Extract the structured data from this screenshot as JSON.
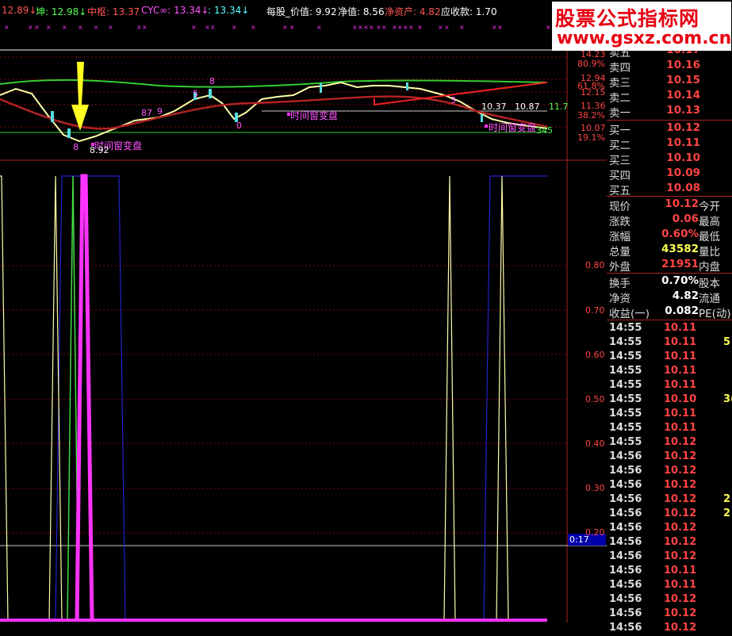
{
  "topbar": {
    "items": [
      {
        "text": "12.89↓",
        "color": "#ff5555"
      },
      {
        "text": "坤: 12.98↓",
        "color": "#55ff55"
      },
      {
        "text": "中枢: 13.37",
        "color": "#ff5555"
      },
      {
        "text": "CYC∞: 13.34↓",
        "color": "#ff55ff"
      },
      {
        "text": ": 13.34↓",
        "color": "#55ffff"
      },
      {
        "text": "每股_价值: 9.92",
        "color": "#ffffff"
      },
      {
        "text": "净值: 8.56",
        "color": "#ffffff"
      },
      {
        "text": "净资产: 4.82",
        "color": "#ff5555"
      },
      {
        "text": "应收款: 1.70",
        "color": "#ffffff"
      }
    ]
  },
  "logo": {
    "line1": "股票公式指标网",
    "line2": "www.gsxz.com.cn"
  },
  "upper_axis": {
    "prices": [
      "14.23",
      "12.94",
      "12.15",
      "11.36",
      "10.07"
    ],
    "percents": [
      "80.9%",
      "61.8%",
      "38.2%",
      "19.1%"
    ]
  },
  "upper_annotations": {
    "label1": "时间窗变盘",
    "label2": "时间窗变盘",
    "label3": "时间窗变盘",
    "low_value": "8.92",
    "low_prefix": "8",
    "val_1037": "10.37",
    "val_1087": "10.87",
    "val_117": "11.7",
    "num_8": "8",
    "num_5": "5",
    "num_0": "0",
    "num_87": "87",
    "num_9": "9",
    "num_345": "345",
    "num_3": "3"
  },
  "lower_axis": {
    "labels": [
      "0.80",
      "0.70",
      "0.60",
      "0.50",
      "0.40",
      "0.30",
      "0.20"
    ],
    "current": "0:17"
  },
  "order_book": {
    "asks": [
      {
        "label": "卖五",
        "price": "10.17"
      },
      {
        "label": "卖四",
        "price": "10.16"
      },
      {
        "label": "卖三",
        "price": "10.15"
      },
      {
        "label": "卖二",
        "price": "10.14"
      },
      {
        "label": "卖一",
        "price": "10.13"
      }
    ],
    "bids": [
      {
        "label": "买一",
        "price": "10.12"
      },
      {
        "label": "买二",
        "price": "10.11"
      },
      {
        "label": "买三",
        "price": "10.10"
      },
      {
        "label": "买四",
        "price": "10.09"
      },
      {
        "label": "买五",
        "price": "10.08"
      }
    ]
  },
  "stats": [
    {
      "label": "现价",
      "value": "10.12",
      "color": "#ff4444",
      "right": "今开"
    },
    {
      "label": "涨跌",
      "value": "0.06",
      "color": "#ff4444",
      "right": "最高"
    },
    {
      "label": "涨幅",
      "value": "0.60%",
      "color": "#ff4444",
      "right": "最低"
    },
    {
      "label": "总量",
      "value": "43582",
      "color": "#ffff55",
      "right": "量比"
    },
    {
      "label": "外盘",
      "value": "21951",
      "color": "#ff4444",
      "right": "内盘"
    }
  ],
  "stats2": [
    {
      "label": "换手",
      "value": "0.70%",
      "color": "#ffffff",
      "right": "股本"
    },
    {
      "label": "净资",
      "value": "4.82",
      "color": "#ffffff",
      "right": "流通"
    },
    {
      "label": "收益(一)",
      "value": "0.082",
      "color": "#ffffff",
      "right": "PE(动)"
    }
  ],
  "ticks": [
    {
      "time": "14:55",
      "price": "10.11",
      "color": "#ff4444",
      "vol": ""
    },
    {
      "time": "14:55",
      "price": "10.11",
      "color": "#ff4444",
      "vol": "5"
    },
    {
      "time": "14:55",
      "price": "10.11",
      "color": "#ff4444",
      "vol": ""
    },
    {
      "time": "14:55",
      "price": "10.11",
      "color": "#ff4444",
      "vol": ""
    },
    {
      "time": "14:55",
      "price": "10.11",
      "color": "#ff4444",
      "vol": ""
    },
    {
      "time": "14:55",
      "price": "10.10",
      "color": "#ff4444",
      "vol": "3("
    },
    {
      "time": "14:55",
      "price": "10.11",
      "color": "#ff4444",
      "vol": ""
    },
    {
      "time": "14:55",
      "price": "10.11",
      "color": "#ff4444",
      "vol": ""
    },
    {
      "time": "14:55",
      "price": "10.12",
      "color": "#ff4444",
      "vol": ""
    },
    {
      "time": "14:56",
      "price": "10.12",
      "color": "#ff4444",
      "vol": ""
    },
    {
      "time": "14:56",
      "price": "10.12",
      "color": "#ff4444",
      "vol": ""
    },
    {
      "time": "14:56",
      "price": "10.12",
      "color": "#ff4444",
      "vol": ""
    },
    {
      "time": "14:56",
      "price": "10.12",
      "color": "#ff4444",
      "vol": "2"
    },
    {
      "time": "14:56",
      "price": "10.12",
      "color": "#ff4444",
      "vol": "2"
    },
    {
      "time": "14:56",
      "price": "10.12",
      "color": "#ff4444",
      "vol": ""
    },
    {
      "time": "14:56",
      "price": "10.12",
      "color": "#ff4444",
      "vol": ""
    },
    {
      "time": "14:56",
      "price": "10.12",
      "color": "#ff4444",
      "vol": ""
    },
    {
      "time": "14:56",
      "price": "10.11",
      "color": "#ff4444",
      "vol": ""
    },
    {
      "time": "14:56",
      "price": "10.11",
      "color": "#ff4444",
      "vol": ""
    },
    {
      "time": "14:56",
      "price": "10.12",
      "color": "#ff4444",
      "vol": ""
    },
    {
      "time": "14:56",
      "price": "10.12",
      "color": "#ff4444",
      "vol": ""
    },
    {
      "time": "14:56",
      "price": "10.12",
      "color": "#ff4444",
      "vol": ""
    }
  ],
  "colors": {
    "grid": "#8b0000",
    "axis": "#aa2222",
    "bars_yellow": "#ffff88",
    "bars_magenta": "#ff33ff",
    "bars_blue": "#2222cc",
    "bars_green": "#44dd44"
  }
}
